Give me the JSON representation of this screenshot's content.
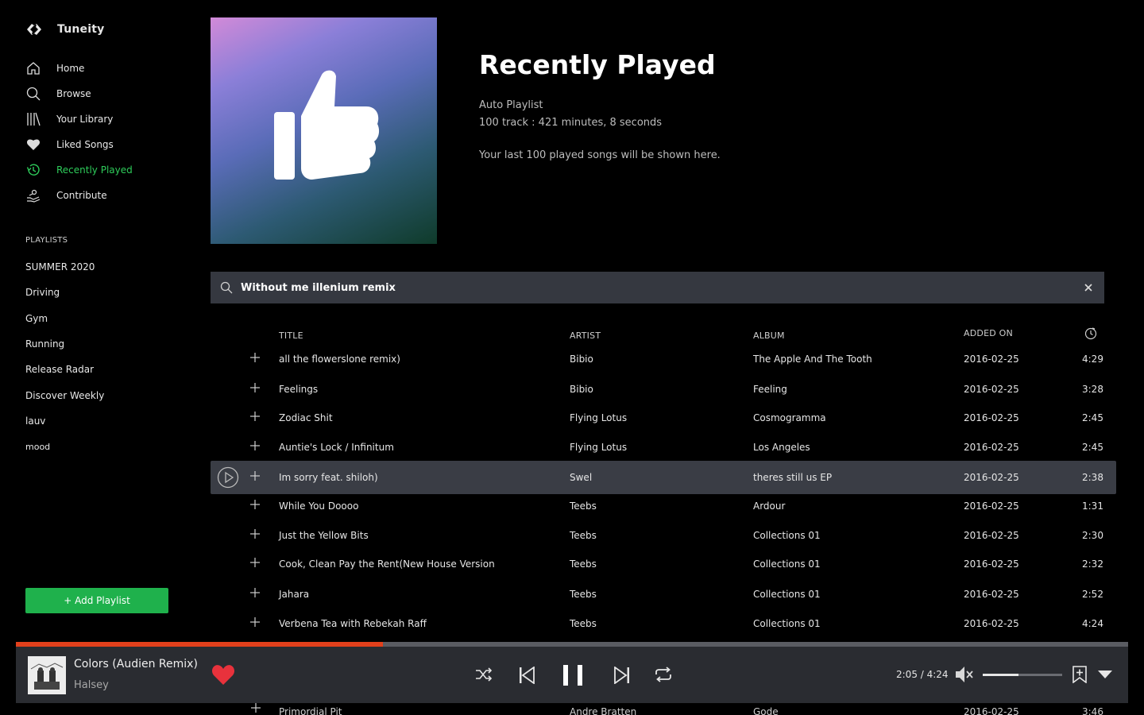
{
  "app": {
    "name": "Tuneity"
  },
  "sidebar": {
    "nav": [
      {
        "label": "Home",
        "icon": "home-icon"
      },
      {
        "label": "Browse",
        "icon": "search-icon"
      },
      {
        "label": "Your Library",
        "icon": "library-icon"
      },
      {
        "label": "Liked Songs",
        "icon": "heart-icon"
      },
      {
        "label": "Recently Played",
        "icon": "history-icon",
        "active": true
      },
      {
        "label": "Contribute",
        "icon": "contribute-icon"
      }
    ],
    "playlists_heading": "PLAYLISTS",
    "playlists": [
      "SUMMER 2020",
      "Driving",
      "Gym",
      "Running",
      "Release Radar",
      "Discover Weekly",
      "lauv",
      "mood"
    ],
    "add_playlist_label": "+ Add Playlist"
  },
  "header": {
    "title": "Recently Played",
    "type": "Auto Playlist",
    "meta": "100 track : 421 minutes, 8 seconds",
    "description": "Your last 100 played songs will be shown here.",
    "cover_icon": "thumbs-up-icon"
  },
  "search": {
    "value": "Without me illenium remix"
  },
  "table": {
    "columns": {
      "title": "TITLE",
      "artist": "ARTIST",
      "album": "ALBUM",
      "added": "ADDED ON",
      "duration_icon": "clock-icon"
    },
    "rows": [
      {
        "title": "all the flowerslone remix)",
        "artist": "Bibio",
        "album": "The Apple And The Tooth",
        "added": "2016-02-25",
        "duration": "4:29"
      },
      {
        "title": "Feelings",
        "artist": "Bibio",
        "album": "Feeling",
        "added": "2016-02-25",
        "duration": "3:28"
      },
      {
        "title": "Zodiac Shit",
        "artist": "Flying Lotus",
        "album": "Cosmogramma",
        "added": "2016-02-25",
        "duration": "2:45"
      },
      {
        "title": "Auntie's Lock / Infinitum",
        "artist": "Flying Lotus",
        "album": "Los Angeles",
        "added": "2016-02-25",
        "duration": "2:45"
      },
      {
        "title": "Im sorry feat. shiloh)",
        "artist": "Swel",
        "album": "theres still us EP",
        "added": "2016-02-25",
        "duration": "2:38",
        "active": true
      },
      {
        "title": "While You Doooo",
        "artist": "Teebs",
        "album": "Ardour",
        "added": "2016-02-25",
        "duration": "1:31"
      },
      {
        "title": "Just the Yellow Bits",
        "artist": "Teebs",
        "album": "Collections 01",
        "added": "2016-02-25",
        "duration": "2:30"
      },
      {
        "title": "Cook, Clean Pay the Rent(New House Version",
        "artist": "Teebs",
        "album": "Collections 01",
        "added": "2016-02-25",
        "duration": "2:32"
      },
      {
        "title": "Jahara",
        "artist": "Teebs",
        "album": "Collections 01",
        "added": "2016-02-25",
        "duration": "2:52"
      },
      {
        "title": "Verbena Tea with Rebekah Raff",
        "artist": "Teebs",
        "album": "Collections 01",
        "added": "2016-02-25",
        "duration": "4:24"
      },
      {
        "title": "Primordial Pit",
        "artist": "Andre Bratten",
        "album": "Gode",
        "added": "2016-02-25",
        "duration": "3:46"
      }
    ]
  },
  "player": {
    "title": "Colors (Audien Remix)",
    "artist": "Halsey",
    "time": "2:05 / 4:24",
    "progress": 0.33,
    "volume": 0.45,
    "liked": true,
    "accent": "#e2401c",
    "heart_color": "#e8323c"
  },
  "colors": {
    "brand_green": "#1fb14c",
    "active_nav": "#2ecc5a"
  }
}
